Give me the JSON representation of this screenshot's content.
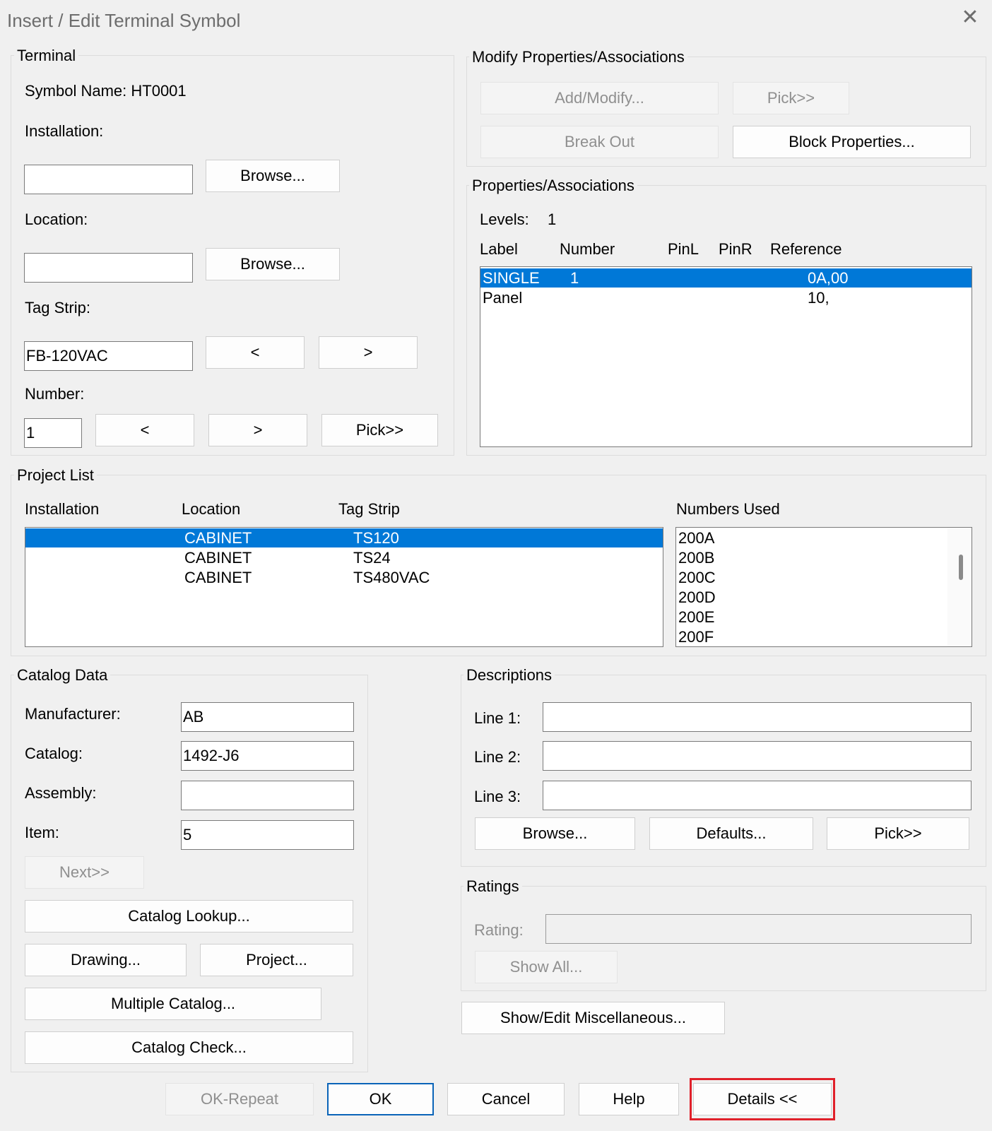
{
  "window": {
    "title": "Insert / Edit Terminal Symbol",
    "close_glyph": "✕"
  },
  "terminal": {
    "group_label": "Terminal",
    "symbol_name": "Symbol Name: HT0001",
    "installation_label": "Installation:",
    "installation_value": "",
    "browse_label": "Browse...",
    "location_label": "Location:",
    "location_value": "",
    "tag_strip_label": "Tag Strip:",
    "tag_strip_value": "FB-120VAC",
    "prev_label": "<",
    "next_label": ">",
    "number_label": "Number:",
    "number_value": "1",
    "pick_label": "Pick>>"
  },
  "modify": {
    "group_label": "Modify Properties/Associations",
    "add_modify": "Add/Modify...",
    "pick": "Pick>>",
    "break_out": "Break Out",
    "block_properties": "Block Properties..."
  },
  "properties": {
    "group_label": "Properties/Associations",
    "levels_label": "Levels:",
    "levels_value": "1",
    "columns": [
      "Label",
      "Number",
      "PinL",
      "PinR",
      "Reference"
    ],
    "rows": [
      {
        "label": "SINGLE",
        "number": "1",
        "pinl": "",
        "pinr": "",
        "reference": "0A,00",
        "selected": true
      },
      {
        "label": "Panel",
        "number": "",
        "pinl": "",
        "pinr": "",
        "reference": "10,",
        "selected": false
      }
    ]
  },
  "project_list": {
    "group_label": "Project List",
    "columns": [
      "Installation",
      "Location",
      "Tag Strip"
    ],
    "numbers_used_label": "Numbers Used",
    "rows": [
      {
        "installation": "",
        "location": "CABINET",
        "tag_strip": "TS120",
        "selected": true
      },
      {
        "installation": "",
        "location": "CABINET",
        "tag_strip": "TS24",
        "selected": false
      },
      {
        "installation": "",
        "location": "CABINET",
        "tag_strip": "TS480VAC",
        "selected": false
      }
    ],
    "numbers_used": [
      "200A",
      "200B",
      "200C",
      "200D",
      "200E",
      "200F"
    ]
  },
  "catalog": {
    "group_label": "Catalog Data",
    "manufacturer_label": "Manufacturer:",
    "manufacturer_value": "AB",
    "catalog_label": "Catalog:",
    "catalog_value": "1492-J6",
    "assembly_label": "Assembly:",
    "assembly_value": "",
    "item_label": "Item:",
    "item_value": "5",
    "next": "Next>>",
    "catalog_lookup": "Catalog Lookup...",
    "drawing": "Drawing...",
    "project": "Project...",
    "multiple_catalog": "Multiple Catalog...",
    "catalog_check": "Catalog Check..."
  },
  "descriptions": {
    "group_label": "Descriptions",
    "line1_label": "Line 1:",
    "line2_label": "Line 2:",
    "line3_label": "Line 3:",
    "line1_value": "",
    "line2_value": "",
    "line3_value": "",
    "browse": "Browse...",
    "defaults": "Defaults...",
    "pick": "Pick>>"
  },
  "ratings": {
    "group_label": "Ratings",
    "rating_label": "Rating:",
    "rating_value": "",
    "show_all": "Show All..."
  },
  "misc": {
    "show_edit": "Show/Edit Miscellaneous..."
  },
  "footer": {
    "ok_repeat": "OK-Repeat",
    "ok": "OK",
    "cancel": "Cancel",
    "help": "Help",
    "details": "Details <<"
  },
  "colors": {
    "selection": "#0078d7",
    "highlight_box": "#e0202a",
    "default_button_border": "#0a64b8"
  }
}
